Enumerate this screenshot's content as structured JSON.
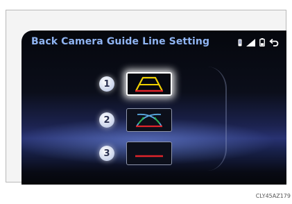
{
  "header": {
    "title": "Back Camera Guide Line Setting"
  },
  "options": [
    {
      "number": "1",
      "selected": true
    },
    {
      "number": "2",
      "selected": false
    },
    {
      "number": "3",
      "selected": false
    }
  ],
  "caption": "CLY45AZ179",
  "colors": {
    "title": "#8fb4f2",
    "guide_yellow": "#f0d000",
    "guide_red": "#e0242a",
    "guide_green": "#29b34a",
    "guide_blue": "#5aa8e0"
  },
  "icons": [
    "phone-icon",
    "signal-icon",
    "battery-icon",
    "back-icon"
  ]
}
